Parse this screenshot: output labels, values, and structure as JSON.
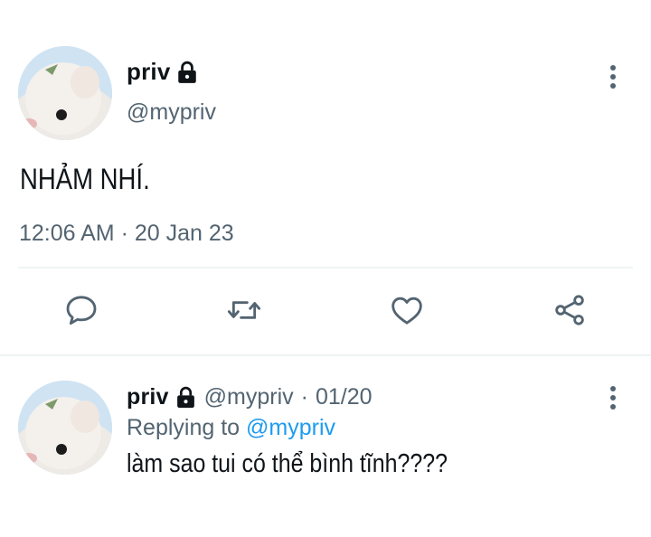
{
  "tweet": {
    "user": {
      "display_name": "priv",
      "handle": "@mypriv",
      "protected_icon": "lock-icon"
    },
    "text": "NHẢM NHÍ.",
    "timestamp": "12:06 AM · 20 Jan 23",
    "actions": [
      {
        "name": "reply",
        "icon": "speech-bubble-icon"
      },
      {
        "name": "retweet",
        "icon": "retweet-icon"
      },
      {
        "name": "like",
        "icon": "heart-icon"
      },
      {
        "name": "share",
        "icon": "share-icon"
      }
    ],
    "menu_icon": "more-vertical-icon"
  },
  "reply": {
    "user": {
      "display_name": "priv",
      "handle": "@mypriv",
      "protected_icon": "lock-icon"
    },
    "separator": "·",
    "date": "01/20",
    "replying_label": "Replying to",
    "replying_to": "@mypriv",
    "text": "làm sao tui có thể bình tĩnh????",
    "menu_icon": "more-vertical-icon"
  },
  "colors": {
    "text": "#0f1419",
    "secondary": "#536471",
    "accent": "#1d9bf0",
    "divider": "#eff3f4"
  }
}
